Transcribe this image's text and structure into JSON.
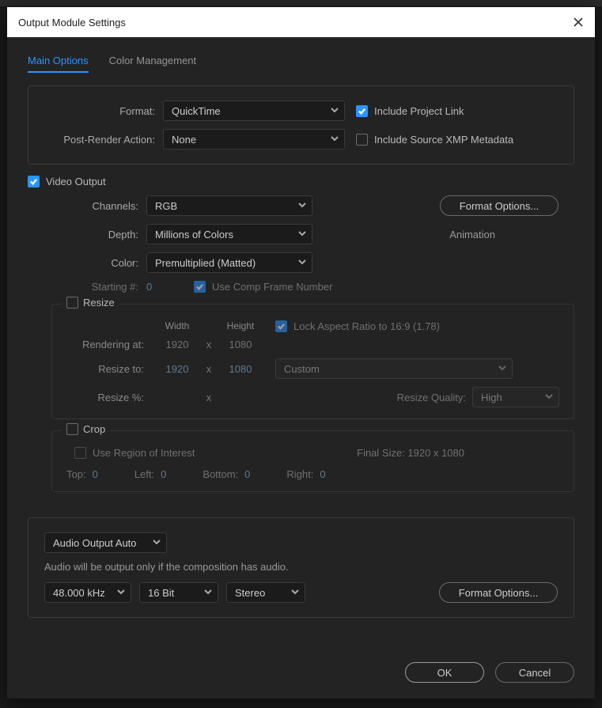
{
  "dialog": {
    "title": "Output Module Settings"
  },
  "tabs": {
    "main": "Main Options",
    "color": "Color Management"
  },
  "format_panel": {
    "format_label": "Format:",
    "format_value": "QuickTime",
    "postrender_label": "Post-Render Action:",
    "postrender_value": "None",
    "include_project_link": "Include Project Link",
    "include_xmp": "Include Source XMP Metadata"
  },
  "video": {
    "section": "Video Output",
    "channels_label": "Channels:",
    "channels_value": "RGB",
    "depth_label": "Depth:",
    "depth_value": "Millions of Colors",
    "color_label": "Color:",
    "color_value": "Premultiplied (Matted)",
    "starting_label": "Starting #:",
    "starting_value": "0",
    "use_comp": "Use Comp Frame Number",
    "codec_label": "Animation",
    "format_options": "Format Options..."
  },
  "resize": {
    "title": "Resize",
    "width": "Width",
    "height": "Height",
    "lock": "Lock Aspect Ratio to 16:9 (1.78)",
    "rendering_at": "Rendering at:",
    "resize_to": "Resize to:",
    "resize_pct": "Resize %:",
    "rw": "1920",
    "rh": "1080",
    "tw": "1920",
    "th": "1080",
    "custom": "Custom",
    "quality_label": "Resize Quality:",
    "quality_value": "High"
  },
  "crop": {
    "title": "Crop",
    "roi": "Use Region of Interest",
    "final_size": "Final Size: 1920 x 1080",
    "top": "Top:",
    "left": "Left:",
    "bottom": "Bottom:",
    "right": "Right:",
    "t": "0",
    "l": "0",
    "b": "0",
    "r": "0"
  },
  "audio": {
    "mode": "Audio Output Auto",
    "note": "Audio will be output only if the composition has audio.",
    "rate": "48.000 kHz",
    "bits": "16 Bit",
    "channels": "Stereo",
    "format_options": "Format Options..."
  },
  "buttons": {
    "ok": "OK",
    "cancel": "Cancel"
  }
}
